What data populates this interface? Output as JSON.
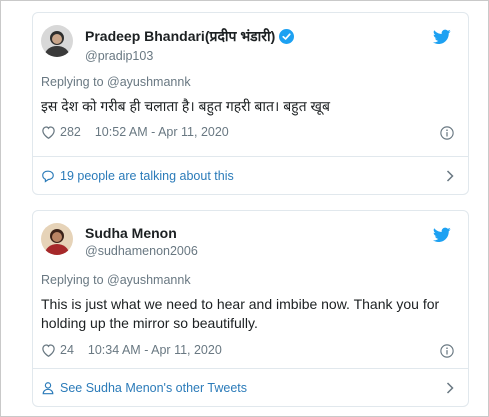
{
  "tweets": [
    {
      "author_name": "Pradeep Bhandari(प्रदीप भंडारी)",
      "handle": "@pradip103",
      "verified": true,
      "replying_to": "Replying to @ayushmannk",
      "text": "इस देश को गरीब ही चलाता है। बहुत गहरी बात। बहुत खूब",
      "likes": "282",
      "timestamp": "10:52 AM - Apr 11, 2020",
      "footer_label": "19 people are talking about this",
      "footer_icon": "comment-icon"
    },
    {
      "author_name": "Sudha Menon",
      "handle": "@sudhamenon2006",
      "verified": false,
      "replying_to": "Replying to @ayushmannk",
      "text": "This is just what we need to hear and imbibe now. Thank you for holding up the mirror so beautifully.",
      "likes": "24",
      "timestamp": "10:34 AM - Apr 11, 2020",
      "footer_label": "See Sudha Menon's other Tweets",
      "footer_icon": "person-icon"
    }
  ],
  "colors": {
    "link": "#2b7bb9",
    "twitter_blue": "#1da1f2",
    "muted": "#697882",
    "border": "#e1e8ed"
  }
}
